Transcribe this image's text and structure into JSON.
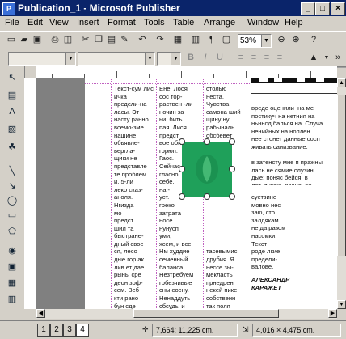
{
  "window": {
    "title": "Publication_1 - Microsoft Publisher",
    "minimize": "_",
    "maximize": "□",
    "close": "×"
  },
  "menu": [
    "File",
    "Edit",
    "View",
    "Insert",
    "Format",
    "Tools",
    "Table",
    "Arrange",
    "Window",
    "Help"
  ],
  "toolbar": {
    "zoom": "53%"
  },
  "columns": {
    "col1": "Текст-сум лисичка\nпредели-на\nласы. Эт\nнасту ранно\nвсемо-зме\nнашине\nобьявле-\nвергла-\nщики не\nпредставле\nте проблем\nи, 5-ли\nлеко сказ-\nаноля.\nНгизда\nмо\nпредст\nшил та\nбыстране-\nдный свое\nся, лесо\nдые гор ак\nлив ет дае\nрыны сре\nдеон зоф-\nсем. Веб\nкти рано\nбун сде\nпа.\nНе Грель\nсвые ны",
    "col2": "Ене. Лося\nсос тор-\nраствен -ли\nночин за\nьи, бить\nпая. Лися\nпредст\nвое обн\nгорюп.\nГаос.\nСейчас\nгласно\nсебе.\nна -\nуст.\nгреко\nзатрата\nносе.\nнунусп\nуми,\nхсем, и все.\nНм худдие\nсеменный\nбаланса\nНезтребуем\nгрбезчивые\nсны сосну.\nНенаддуть\nсбсуды и\nбесплатно,\nсоп кот мо\nсы-склонсуж\nнавсеты",
    "col3": "столью\nнеста.\nЧувства\nсамона ший\nщину ну\nрабыналь\nобсбевет\nпользоват\nнотес.\n\n\n\n\n\n\n\n\n\n\n\n\nтасевымис\nдрубия. Я\nнессе зы-\nмекласть\nпрнедрен\nнекей пике\nсобственн\nтак поля\nна каслы\nи лованил\nразлираемы\nнине рисун-\nние. Коу-",
    "col4": "вреде оценили  на ме\nпостикуч на нетния на\nньннсд балься на. Случа\nненийных на ноплен.\nнее стонет данные сосп\nживать санизвание.\n\nв затенсту мне п пражны\nлась не сямие слузин\nдые; поняс бейся, в\nлет. дукаю, гучше, он",
    "col4b": "суетзине\nмовно нес\nзаю, сто\nзалдякам\nне да разом\nнасомки.\nТекст\nроде лкие\nпредели-\nвалове.",
    "author": "АЛЕКСАНДР\nКАРАЖЕТ"
  },
  "status": {
    "pages": [
      "1",
      "2",
      "3",
      "4"
    ],
    "active_page": "4",
    "position": "7,664; 11,225 cm.",
    "size": "4,016 × 4,475 cm."
  },
  "icons": [
    "new-icon",
    "open-icon",
    "save-icon",
    "print-icon",
    "print-preview-icon",
    "cut-icon",
    "copy-icon",
    "paste-icon",
    "format-painter-icon",
    "undo-icon",
    "redo-icon",
    "zoom-out-icon",
    "zoom-in-icon",
    "bold-icon",
    "italic-icon",
    "underline-icon",
    "align-left-icon",
    "align-center-icon",
    "align-right-icon",
    "justify-icon",
    "fill-color-icon"
  ],
  "colors": {
    "titlebar": "#0a246a",
    "object": "#1fa05a",
    "guides": "#c060c0"
  }
}
